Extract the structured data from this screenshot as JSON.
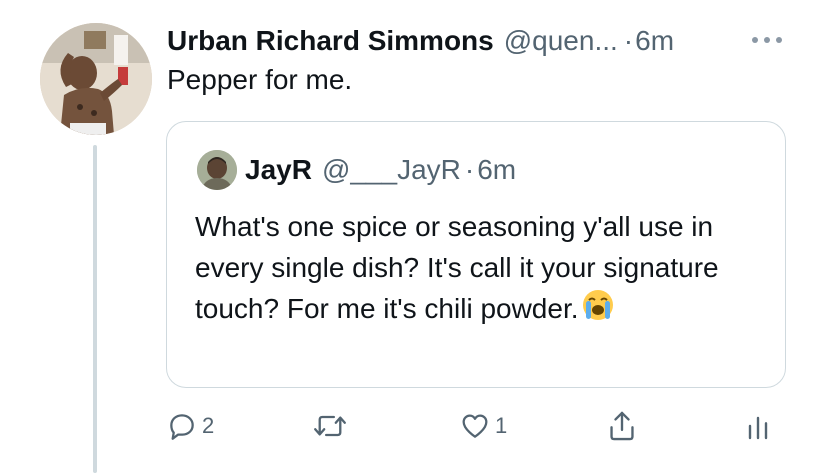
{
  "tweet": {
    "author_name": "Urban Richard Simmons",
    "author_handle": "@quen...",
    "separator": "·",
    "time": "6m",
    "text": "Pepper for me."
  },
  "quoted_tweet": {
    "author_name": "JayR",
    "author_handle": "@___JayR",
    "separator": "·",
    "time": "6m",
    "text": "What's one spice or seasoning y'all use in every single dish? It's call it your signature touch? For me it's chili powder.",
    "emoji": "loudly-crying-face"
  },
  "actions": {
    "reply_count": "2",
    "retweet_count": "",
    "like_count": "1"
  },
  "colors": {
    "text": "#0f1419",
    "secondary": "#536471",
    "border": "#cfd9de",
    "thread_line": "#cfd9de"
  }
}
